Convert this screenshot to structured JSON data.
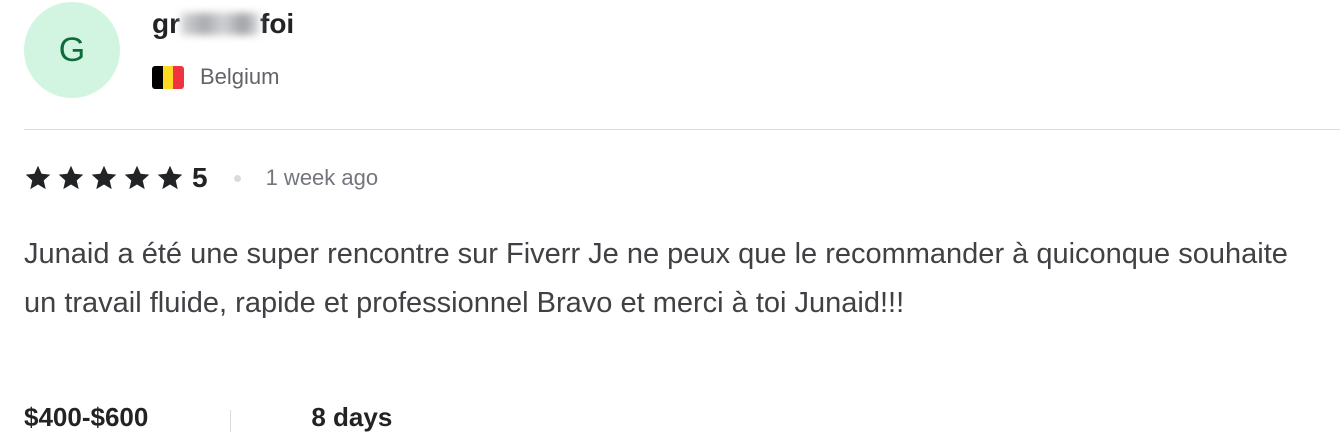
{
  "reviewer": {
    "avatar_initial": "G",
    "name_prefix": "gr",
    "name_suffix": "foi",
    "country": "Belgium",
    "flag_colors": [
      "#000000",
      "#FDDA24",
      "#EF3340"
    ],
    "avatar_bg": "#D2F5E2"
  },
  "review": {
    "stars": 5,
    "rating_label": "5",
    "time_ago": "1 week ago",
    "text": "Junaid a été une super rencontre sur Fiverr Je ne peux que le recommander à quiconque souhaite un travail fluide, rapide et professionnel Bravo et merci à toi Junaid!!!"
  },
  "order": {
    "price": "$400-$600",
    "duration": "8 days"
  }
}
